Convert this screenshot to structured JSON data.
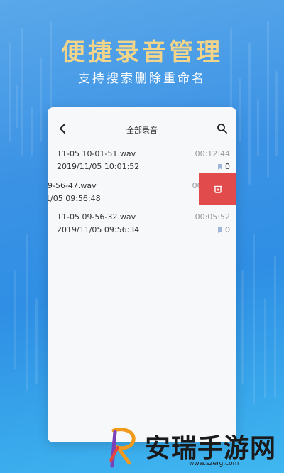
{
  "promo": {
    "headline": "便捷录音管理",
    "subline": "支持搜索删除重命名"
  },
  "screen": {
    "title": "全部录音",
    "icons": {
      "back": "back-arrow-icon",
      "search": "search-icon",
      "delete": "trash-icon"
    },
    "recordings": [
      {
        "name": "11-05 10-01-51.wav",
        "date": "2019/11/05 10:01:52",
        "duration": "00:12:44",
        "marks": "0"
      },
      {
        "name": "9-56-47.wav",
        "date": "1/05 09:56:48",
        "duration": "00:05:47",
        "marks": "0"
      },
      {
        "name": "11-05 09-56-32.wav",
        "date": "2019/11/05 09:56:34",
        "duration": "00:05:52",
        "marks": "0"
      }
    ]
  },
  "watermark": {
    "brand": "安瑞手游网",
    "url": "www.szerg.com"
  },
  "colors": {
    "accent_gold": "#f3d58a",
    "delete_red": "#e24b4b",
    "bookmark_blue": "#9fb6d8"
  }
}
